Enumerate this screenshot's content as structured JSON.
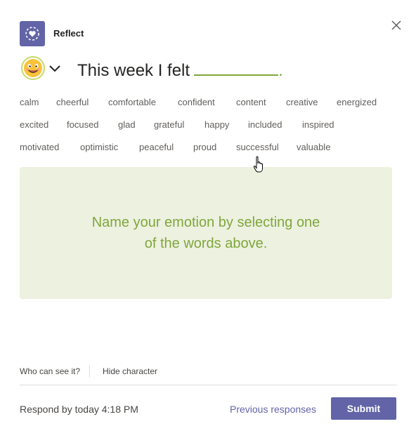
{
  "app": {
    "title": "Reflect",
    "icon": "reflect-heart-icon",
    "accent": "#6264a7"
  },
  "header": {
    "close_icon": "close-icon"
  },
  "prompt": {
    "text": "This week I felt",
    "period": ".",
    "character_icon": "smiley-character-icon",
    "dropdown_icon": "chevron-down-icon"
  },
  "words": [
    "calm",
    "cheerful",
    "comfortable",
    "confident",
    "content",
    "creative",
    "energized",
    "excited",
    "focused",
    "glad",
    "grateful",
    "happy",
    "included",
    "inspired",
    "motivated",
    "optimistic",
    "peaceful",
    "proud",
    "successful",
    "valuable"
  ],
  "hint": {
    "text": "Name your emotion by selecting one of the words above.",
    "color": "#7fa63b",
    "background": "#edf1e0"
  },
  "footer": {
    "who_can_see": "Who can see it?",
    "hide_character": "Hide character",
    "respond_by": "Respond by today 4:18 PM",
    "previous_responses": "Previous responses",
    "submit": "Submit"
  }
}
